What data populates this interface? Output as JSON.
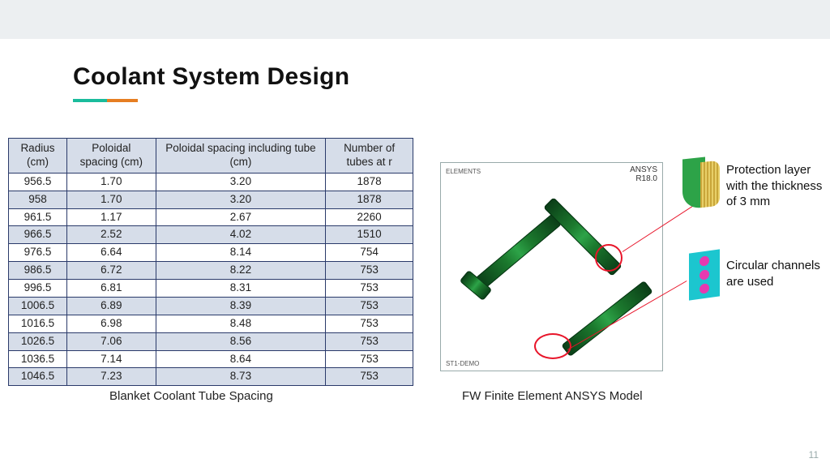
{
  "title": "Coolant System Design",
  "table": {
    "headers": [
      "Radius (cm)",
      "Poloidal spacing (cm)",
      "Poloidal spacing including tube (cm)",
      "Number of tubes at r"
    ],
    "rows": [
      [
        "956.5",
        "1.70",
        "3.20",
        "1878"
      ],
      [
        "958",
        "1.70",
        "3.20",
        "1878"
      ],
      [
        "961.5",
        "1.17",
        "2.67",
        "2260"
      ],
      [
        "966.5",
        "2.52",
        "4.02",
        "1510"
      ],
      [
        "976.5",
        "6.64",
        "8.14",
        "754"
      ],
      [
        "986.5",
        "6.72",
        "8.22",
        "753"
      ],
      [
        "996.5",
        "6.81",
        "8.31",
        "753"
      ],
      [
        "1006.5",
        "6.89",
        "8.39",
        "753"
      ],
      [
        "1016.5",
        "6.98",
        "8.48",
        "753"
      ],
      [
        "1026.5",
        "7.06",
        "8.56",
        "753"
      ],
      [
        "1036.5",
        "7.14",
        "8.64",
        "753"
      ],
      [
        "1046.5",
        "7.23",
        "8.73",
        "753"
      ]
    ]
  },
  "captions": {
    "table": "Blanket Coolant Tube Spacing",
    "figure": "FW Finite Element ANSYS Model"
  },
  "figure": {
    "software": "ANSYS",
    "version": "R18.0",
    "corner": "ELEMENTS",
    "bottom": "ST1-DEMO"
  },
  "annotations": {
    "protection": "Protection layer with the thickness of 3 mm",
    "channels": "Circular channels are used"
  },
  "page_number": "11",
  "chart_data": {
    "type": "table",
    "title": "Blanket Coolant Tube Spacing",
    "columns": [
      "Radius (cm)",
      "Poloidal spacing (cm)",
      "Poloidal spacing including tube (cm)",
      "Number of tubes at r"
    ],
    "rows": [
      [
        956.5,
        1.7,
        3.2,
        1878
      ],
      [
        958,
        1.7,
        3.2,
        1878
      ],
      [
        961.5,
        1.17,
        2.67,
        2260
      ],
      [
        966.5,
        2.52,
        4.02,
        1510
      ],
      [
        976.5,
        6.64,
        8.14,
        754
      ],
      [
        986.5,
        6.72,
        8.22,
        753
      ],
      [
        996.5,
        6.81,
        8.31,
        753
      ],
      [
        1006.5,
        6.89,
        8.39,
        753
      ],
      [
        1016.5,
        6.98,
        8.48,
        753
      ],
      [
        1026.5,
        7.06,
        8.56,
        753
      ],
      [
        1036.5,
        7.14,
        8.64,
        753
      ],
      [
        1046.5,
        7.23,
        8.73,
        753
      ]
    ]
  }
}
